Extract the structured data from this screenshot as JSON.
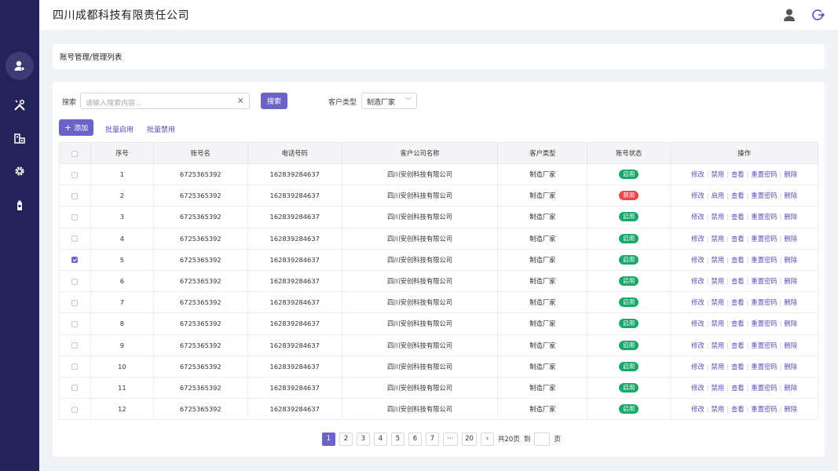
{
  "header": {
    "company": "四川成都科技有限责任公司"
  },
  "breadcrumb": "账号管理/管理列表",
  "filters": {
    "search_label": "搜索",
    "search_placeholder": "请输入搜索内容...",
    "search_button": "搜索",
    "type_label": "客户类型",
    "type_value": "制造厂家"
  },
  "actions": {
    "add": "添加",
    "batch_enable": "批量启用",
    "batch_disable": "批量禁用"
  },
  "table": {
    "columns": [
      "序号",
      "账号名",
      "电话号码",
      "客户公司名称",
      "客户类型",
      "账号状态",
      "操作"
    ],
    "rows": [
      {
        "no": "1",
        "account": "6725365392",
        "phone": "162839284637",
        "company": "四川安创科技有限公司",
        "type": "制造厂家",
        "status": "启用",
        "toggle": "禁用",
        "checked": false
      },
      {
        "no": "2",
        "account": "6725365392",
        "phone": "162839284637",
        "company": "四川安创科技有限公司",
        "type": "制造厂家",
        "status": "禁用",
        "toggle": "启用",
        "checked": false
      },
      {
        "no": "3",
        "account": "6725365392",
        "phone": "162839284637",
        "company": "四川安创科技有限公司",
        "type": "制造厂家",
        "status": "启用",
        "toggle": "禁用",
        "checked": false
      },
      {
        "no": "4",
        "account": "6725365392",
        "phone": "162839284637",
        "company": "四川安创科技有限公司",
        "type": "制造厂家",
        "status": "启用",
        "toggle": "禁用",
        "checked": false
      },
      {
        "no": "5",
        "account": "6725365392",
        "phone": "162839284637",
        "company": "四川安创科技有限公司",
        "type": "制造厂家",
        "status": "启用",
        "toggle": "禁用",
        "checked": true
      },
      {
        "no": "6",
        "account": "6725365392",
        "phone": "162839284637",
        "company": "四川安创科技有限公司",
        "type": "制造厂家",
        "status": "启用",
        "toggle": "禁用",
        "checked": false
      },
      {
        "no": "7",
        "account": "6725365392",
        "phone": "162839284637",
        "company": "四川安创科技有限公司",
        "type": "制造厂家",
        "status": "启用",
        "toggle": "禁用",
        "checked": false
      },
      {
        "no": "8",
        "account": "6725365392",
        "phone": "162839284637",
        "company": "四川安创科技有限公司",
        "type": "制造厂家",
        "status": "启用",
        "toggle": "禁用",
        "checked": false
      },
      {
        "no": "9",
        "account": "6725365392",
        "phone": "162839284637",
        "company": "四川安创科技有限公司",
        "type": "制造厂家",
        "status": "启用",
        "toggle": "禁用",
        "checked": false
      },
      {
        "no": "10",
        "account": "6725365392",
        "phone": "162839284637",
        "company": "四川安创科技有限公司",
        "type": "制造厂家",
        "status": "启用",
        "toggle": "禁用",
        "checked": false
      },
      {
        "no": "11",
        "account": "6725365392",
        "phone": "162839284637",
        "company": "四川安创科技有限公司",
        "type": "制造厂家",
        "status": "启用",
        "toggle": "禁用",
        "checked": false
      },
      {
        "no": "12",
        "account": "6725365392",
        "phone": "162839284637",
        "company": "四川安创科技有限公司",
        "type": "制造厂家",
        "status": "启用",
        "toggle": "禁用",
        "checked": false
      }
    ],
    "ops": {
      "edit": "修改",
      "view": "查看",
      "reset": "重置密码",
      "delete": "删除"
    }
  },
  "pagination": {
    "pages": [
      "1",
      "2",
      "3",
      "4",
      "5",
      "6",
      "7"
    ],
    "ellipsis": "···",
    "last": "20",
    "next": "›",
    "total": "共20页",
    "goto": "到",
    "page_unit": "页",
    "current": "1"
  },
  "colors": {
    "sidebar": "#25215b",
    "primary": "#6b63c8",
    "enabled": "#1aa76a",
    "disabled": "#e8484a"
  }
}
